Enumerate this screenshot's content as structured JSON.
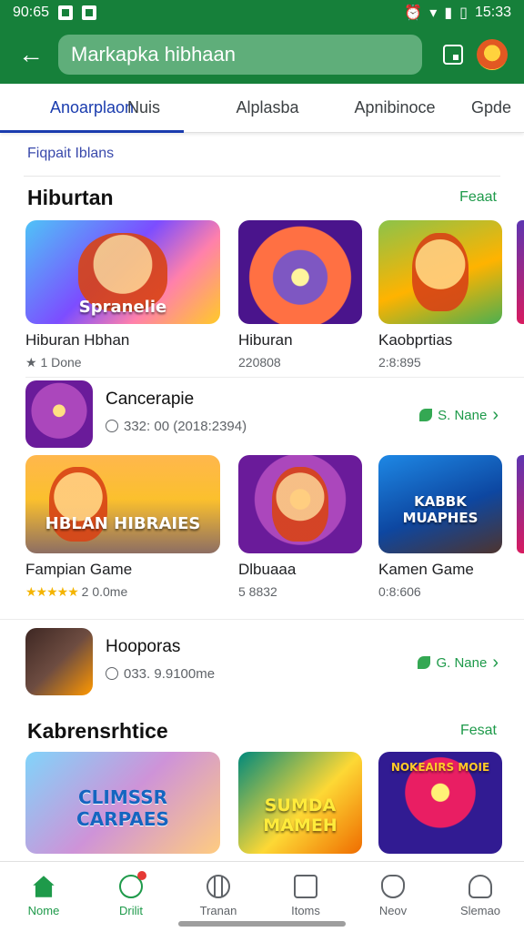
{
  "status_bar": {
    "time_left": "90:65",
    "time_right": "15:33"
  },
  "app_bar": {
    "search_value": "Markapka hibhaan"
  },
  "tabs": [
    {
      "label": "Anoarplaon",
      "active": true
    },
    {
      "label": "Nuis"
    },
    {
      "label": "Alplasba"
    },
    {
      "label": "Apnibinoce"
    },
    {
      "label": "Gpde"
    }
  ],
  "sub_link": "Fiqpait Iblans",
  "section1": {
    "title": "Hiburtan",
    "link": "Feaat",
    "cards": [
      {
        "name": "Hiburan Hbhan",
        "meta": "★ 1 Done",
        "logo": "Spranelie"
      },
      {
        "name": "Hiburan",
        "meta": "220808",
        "logo": ""
      },
      {
        "name": "Kaobprtias",
        "meta": "2:8:895",
        "logo": ""
      }
    ]
  },
  "app_row1": {
    "name": "Cancerapie",
    "meta": "332: 00   (2018:2394)",
    "install": "S. Nane"
  },
  "section2_cards": [
    {
      "name": "Fampian Game",
      "rating": "★★★★★",
      "meta": "2 0.0me",
      "logo": "HBLAN HIBRAIES"
    },
    {
      "name": "Dlbuaaa",
      "rating": "",
      "meta": "5 8832",
      "logo": ""
    },
    {
      "name": "Kamen Game",
      "rating": "",
      "meta": "0:8:606",
      "logo": "KABBK MUAPHES"
    }
  ],
  "app_row2": {
    "name": "Hooporas",
    "meta": "033. 9.9100me",
    "install": "G. Nane"
  },
  "section3": {
    "title": "Kabrensrhtice",
    "link": "Fesat",
    "cards": [
      {
        "logo": "CLIMSSR CARPAES"
      },
      {
        "logo": "SUMDA MAMEH"
      },
      {
        "logo": "NOKEAIRS MOIE"
      }
    ]
  },
  "bottom_nav": [
    {
      "label": "Nome",
      "active": true
    },
    {
      "label": "Drilit"
    },
    {
      "label": "Tranan"
    },
    {
      "label": "Itoms"
    },
    {
      "label": "Neov"
    },
    {
      "label": "Slemao"
    }
  ],
  "colors": {
    "brand": "#16803a",
    "accent_tab": "#1a3cae",
    "link": "#1e9a4a"
  }
}
